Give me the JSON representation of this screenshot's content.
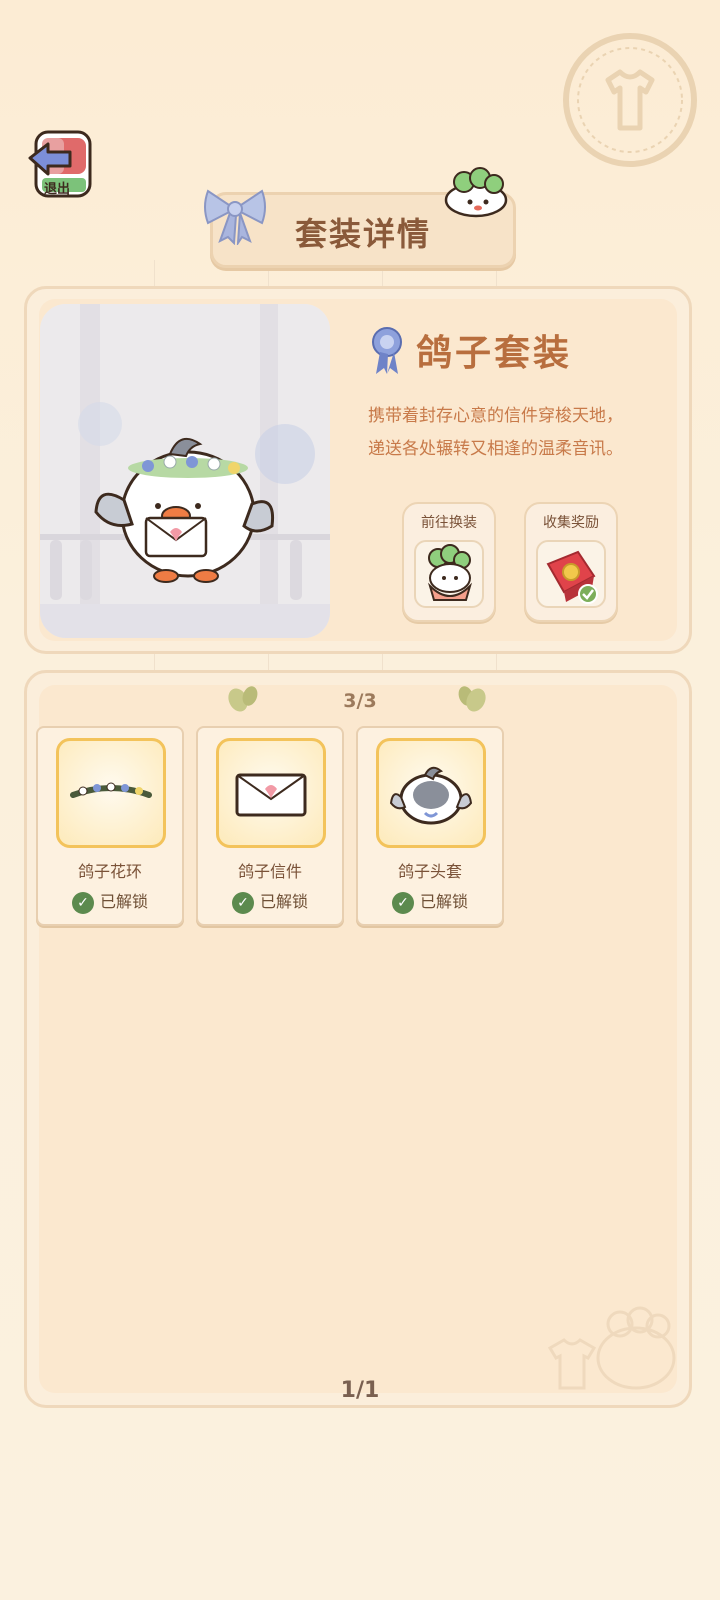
{
  "header": {
    "exit_label": "退出",
    "title": "套装详情"
  },
  "set": {
    "name": "鸽子套装",
    "description_line1": "携带着封存心意的信件穿梭天地，",
    "description_line2": "递送各处辗转又相逢的温柔音讯。",
    "actions": [
      {
        "label": "前往换装",
        "icon": "outfit-preview-icon"
      },
      {
        "label": "收集奖励",
        "icon": "reward-gift-icon",
        "claimed": true
      }
    ]
  },
  "items_section": {
    "progress": "3/3",
    "items": [
      {
        "name": "鸽子花环",
        "status": "已解锁",
        "icon": "flower-wreath-icon"
      },
      {
        "name": "鸽子信件",
        "status": "已解锁",
        "icon": "letter-envelope-icon"
      },
      {
        "name": "鸽子头套",
        "status": "已解锁",
        "icon": "pigeon-hood-icon"
      }
    ],
    "page": "1/1"
  },
  "colors": {
    "background": "#fbefd8",
    "accent_brown": "#b86e3e",
    "gold_border": "#f3c35b",
    "check_green": "#5c8a4e"
  }
}
